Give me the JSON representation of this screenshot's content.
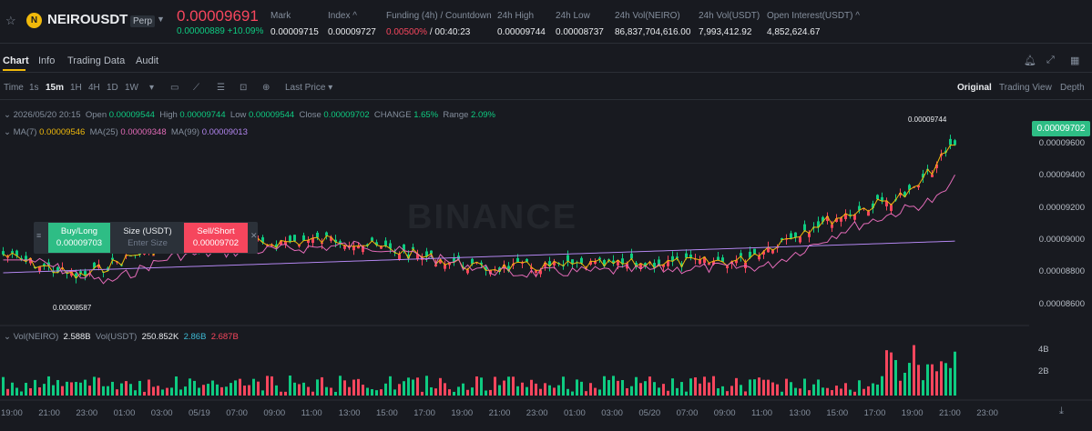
{
  "header": {
    "symbol": "NEIROUSDT",
    "perp": "Perp",
    "last_price": "0.00009691",
    "change": "0.00000889 +10.09%",
    "stats": [
      {
        "label": "Mark",
        "value": "0.00009715"
      },
      {
        "label": "Index ^",
        "value": "0.00009727"
      },
      {
        "label": "Funding (4h) / Countdown",
        "value_red": "0.00500%",
        "value": "/ 00:40:23"
      },
      {
        "label": "24h High",
        "value": "0.00009744"
      },
      {
        "label": "24h Low",
        "value": "0.00008737"
      },
      {
        "label": "24h Vol(NEIRO)",
        "value": "86,837,704,616.00"
      },
      {
        "label": "24h Vol(USDT)",
        "value": "7,993,412.92"
      },
      {
        "label": "Open Interest(USDT) ^",
        "value": "4,852,624.67"
      }
    ]
  },
  "tabs": [
    "Chart",
    "Info",
    "Trading Data",
    "Audit"
  ],
  "toolbar": {
    "intervals": [
      "Time",
      "1s",
      "15m",
      "1H",
      "4H",
      "1D",
      "1W"
    ],
    "active": "15m",
    "price_mode": "Last Price",
    "views": [
      "Original",
      "Trading View",
      "Depth"
    ],
    "active_view": "Original"
  },
  "ohlc": {
    "date": "2026/05/20 20:15",
    "open_label": "Open",
    "open": "0.00009544",
    "high_label": "High",
    "high": "0.00009744",
    "low_label": "Low",
    "low": "0.00009544",
    "close_label": "Close",
    "close": "0.00009702",
    "change_label": "CHANGE",
    "change": "1.65%",
    "range_label": "Range",
    "range": "2.09%"
  },
  "ma": {
    "ma7_label": "MA(7)",
    "ma7": "0.00009546",
    "ma25_label": "MA(25)",
    "ma25": "0.00009348",
    "ma99_label": "MA(99)",
    "ma99": "0.00009013"
  },
  "vol": {
    "neiro_label": "Vol(NEIRO)",
    "neiro": "2.588B",
    "usdt_label": "Vol(USDT)",
    "usdt": "250.852K",
    "v1": "2.86B",
    "v2": "2.687B"
  },
  "order_panel": {
    "buy": "Buy/Long",
    "buy_price": "0.00009703",
    "size": "Size (USDT)",
    "size_placeholder": "Enter Size",
    "sell": "Sell/Short",
    "sell_price": "0.00009702"
  },
  "watermark": "BINANCE",
  "current_price": "0.00009702",
  "high_marker": "0.00009744",
  "low_marker": "0.00008587",
  "price_axis": [
    "0.00009600",
    "0.00009400",
    "0.00009200",
    "0.00009000",
    "0.00008800",
    "0.00008600"
  ],
  "vol_axis": [
    "4B",
    "2B"
  ],
  "time_axis": [
    "19:00",
    "21:00",
    "23:00",
    "01:00",
    "03:00",
    "05/19",
    "07:00",
    "09:00",
    "11:00",
    "13:00",
    "15:00",
    "17:00",
    "19:00",
    "21:00",
    "23:00",
    "01:00",
    "03:00",
    "05/20",
    "07:00",
    "09:00",
    "11:00",
    "13:00",
    "15:00",
    "17:00",
    "19:00",
    "21:00",
    "23:00"
  ],
  "colors": {
    "up": "#0ecb81",
    "down": "#f6465d",
    "ma7": "#f0b90b",
    "ma25": "#e36bb8",
    "ma99": "#b185ee"
  }
}
